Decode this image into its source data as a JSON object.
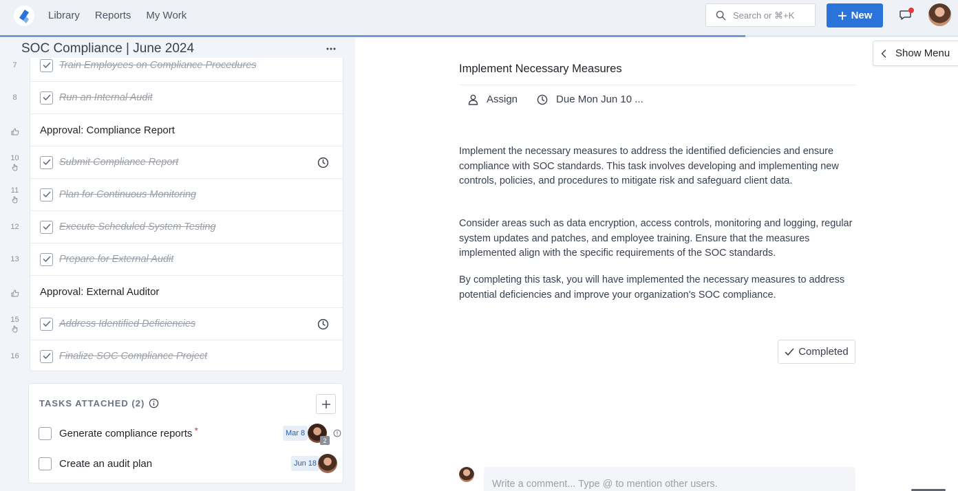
{
  "nav": {
    "items": [
      "Library",
      "Reports",
      "My Work"
    ]
  },
  "search": {
    "placeholder": "Search or ⌘+K"
  },
  "toolbar": {
    "new_label": "New"
  },
  "header": {
    "progress_percent": 77.8
  },
  "project": {
    "title": "SOC Compliance | June 2024"
  },
  "checklist": [
    {
      "num": "7",
      "label": "Train Employees on Compliance Procedures",
      "type": "task",
      "done": true,
      "clock": false,
      "hand": false
    },
    {
      "num": "8",
      "label": "Run an Internal Audit",
      "type": "task",
      "done": true,
      "clock": false,
      "hand": false
    },
    {
      "num": "",
      "label": "Approval: Compliance Report",
      "type": "approval",
      "done": false,
      "clock": false,
      "hand": false
    },
    {
      "num": "10",
      "label": "Submit Compliance Report",
      "type": "task",
      "done": true,
      "clock": true,
      "hand": true
    },
    {
      "num": "11",
      "label": "Plan for Continuous Monitoring",
      "type": "task",
      "done": true,
      "clock": false,
      "hand": true
    },
    {
      "num": "12",
      "label": "Execute Scheduled System Testing",
      "type": "task",
      "done": true,
      "clock": false,
      "hand": false
    },
    {
      "num": "13",
      "label": "Prepare for External Audit",
      "type": "task",
      "done": true,
      "clock": false,
      "hand": false
    },
    {
      "num": "",
      "label": "Approval: External Auditor",
      "type": "approval",
      "done": false,
      "clock": false,
      "hand": false
    },
    {
      "num": "15",
      "label": "Address Identified Deficiencies",
      "type": "task",
      "done": true,
      "clock": true,
      "hand": true
    },
    {
      "num": "16",
      "label": "Finalize SOC Compliance Project",
      "type": "task",
      "done": true,
      "clock": false,
      "hand": false
    }
  ],
  "tasks_attached": {
    "title": "TASKS ATTACHED (2)",
    "items": [
      {
        "label": "Generate compliance reports",
        "required": true,
        "date": "Mar 8",
        "badge": "2",
        "info": true
      },
      {
        "label": "Create an audit plan",
        "required": false,
        "date": "Jun 18",
        "badge": "",
        "info": false
      }
    ]
  },
  "detail": {
    "title": "Implement Necessary Measures",
    "assign_label": "Assign",
    "due_label": "Due Mon Jun 10 ...",
    "paragraphs": [
      "Implement the necessary measures to address the identified deficiencies and ensure compliance with SOC standards. This task involves developing and implementing new controls, policies, and procedures to mitigate risk and safeguard client data.",
      "Consider areas such as data encryption, access controls, monitoring and logging, regular system updates and patches, and employee training. Ensure that the measures implemented align with the specific requirements of the SOC standards.",
      "By completing this task, you will have implemented the necessary measures to address potential deficiencies and improve your organization's SOC compliance."
    ],
    "completed_label": "Completed"
  },
  "show_menu": {
    "label": "Show Menu"
  },
  "comment": {
    "placeholder": "Write a comment... Type @ to mention other users."
  },
  "colors": {
    "accent": "#2a73d9",
    "notification": "#e53935"
  }
}
